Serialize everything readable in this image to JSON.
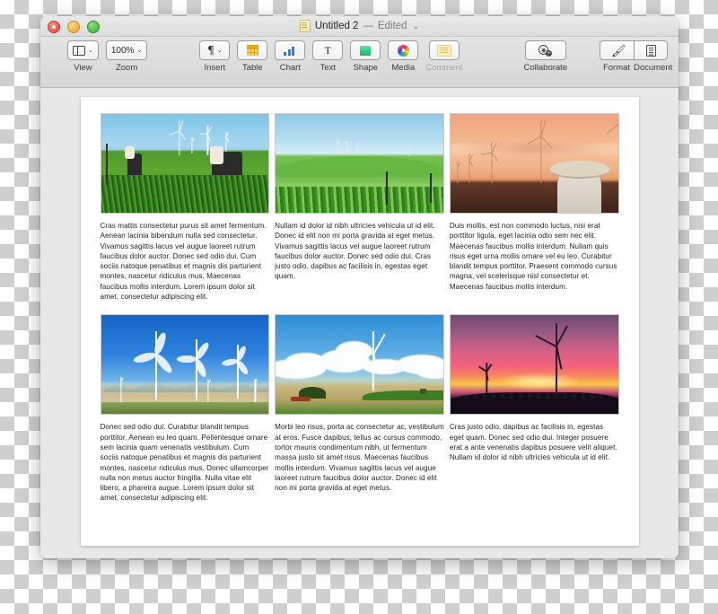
{
  "window": {
    "title_name": "Untitled 2",
    "title_dash": "—",
    "title_edited": "Edited",
    "title_chevron": "⌄",
    "traffic": {
      "close": "close-button",
      "minimize": "minimize-button",
      "maximize": "maximize-button"
    }
  },
  "toolbar": {
    "view_label": "View",
    "zoom_label": "Zoom",
    "zoom_value": "100%",
    "insert_label": "Insert",
    "table_label": "Table",
    "chart_label": "Chart",
    "text_label": "Text",
    "shape_label": "Shape",
    "media_label": "Media",
    "comment_label": "Comment",
    "collaborate_label": "Collaborate",
    "format_label": "Format",
    "document_label": "Document",
    "chevron": "⌄"
  },
  "document": {
    "cells": [
      {
        "image_name": "photo-cows-wind-farm",
        "caption": "Cras mattis consectetur purus sit amet fermentum. Aenean lacinia bibendum nulla sed consectetur. Vivamus sagittis lacus vel augue laoreet rutrum faucibus dolor auctor. Donec sed odio dui. Cum sociis natoque penatibus et magnis dis parturient montes, nascetur ridiculus mus. Maecenas faucibus mollis interdum. Lorem ipsum dolor sit amet, consectetur adipiscing elit."
      },
      {
        "image_name": "photo-green-hills-turbines",
        "caption": "Nullam id dolor id nibh ultricies vehicula ut id elit. Donec id elit non mi porta gravida at eget metus. Vivamus sagittis lacus vel augue laoreet rutrum faucibus dolor auctor. Donec sed odio dui. Cras justo odio, dapibus ac facilisis in, egestas eget quam."
      },
      {
        "image_name": "photo-sunset-farmer-turbines",
        "caption": "Duis mollis, est non commodo luctus, nisi erat porttitor ligula, eget lacinia odio sem nec elit. Maecenas faucibus mollis interdum. Nullam quis risus eget urna mollis ornare vel eu leo. Curabitur blandit tempus porttitor. Praesent commodo cursus magna, vel scelerisque nisl consectetur et. Maecenas faucibus mollis interdum."
      },
      {
        "image_name": "photo-white-turbines-blue-sky",
        "caption": "Donec sed odio dui. Curabitur blandit tempus porttitor. Aenean eu leo quam. Pellentesque ornare sem lacinia quam venenatis vestibulum. Cum sociis natoque penatibus et magnis dis parturient montes, nascetur ridiculus mus. Donec ullamcorper nulla non metus auctor fringilla. Nulla vitae elit libero, a pharetra augue. Lorem ipsum dolor sit amet, consectetur adipiscing elit."
      },
      {
        "image_name": "photo-single-turbine-clouds",
        "caption": "Morbi leo risus, porta ac consectetur ac, vestibulum at eros. Fusce dapibus, tellus ac cursus commodo, tortor mauris condimentum nibh, ut fermentum massa justo sit amet risus. Maecenas faucibus mollis interdum. Vivamus sagittis lacus vel augue laoreet rutrum faucibus dolor auctor. Donec id elit non mi porta gravida at eget metus."
      },
      {
        "image_name": "photo-pink-sunset-turbines",
        "caption": "Cras justo odio, dapibus ac facilisis in, egestas eget quam. Donec sed odio dui. Integer posuere erat a ante venenatis dapibus posuere velit aliquet. Nullam id dolor id nibh ultricies vehicula ut id elit."
      }
    ]
  },
  "colors": {
    "titlebar": "#e2e2e2",
    "toolbar": "#dcdcdc",
    "canvas": "#e8e8e8",
    "paper": "#ffffff",
    "close": "#e0463c",
    "minimize": "#e5a02a",
    "maximize": "#2fae33",
    "chart_accent": "#2e7fd4",
    "table_accent": "#ffd34d",
    "shape_accent": "#17b36b"
  }
}
